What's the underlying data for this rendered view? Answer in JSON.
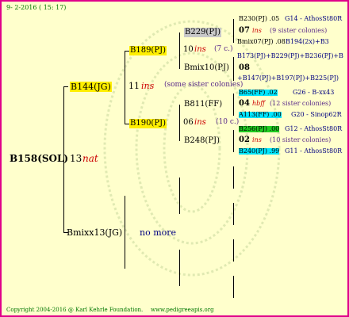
{
  "header": {
    "date": "9-  2-2016 ( 15: 17)"
  },
  "footer": {
    "copyright": "Copyright 2004-2016 @ Karl Kehrle Foundation.",
    "site": "www.pedigreeapis.org"
  },
  "root": {
    "name": "B158(SOL)",
    "num": "13",
    "note": "nat"
  },
  "gen1": {
    "top": {
      "name": "B144(JG)",
      "num": "11",
      "note": "ins",
      "extra": "(some sister colonies)"
    },
    "bottom": {
      "name": "Bmixx13(JG)",
      "extra": "no more"
    }
  },
  "gen2": {
    "a": {
      "name": "B189(PJ)",
      "num": "10",
      "note": "ins",
      "extra": "(7 c.)"
    },
    "b": {
      "name": "B190(PJ)",
      "num": "06",
      "note": "ins",
      "extra": "(10 c.)"
    }
  },
  "gen3": {
    "a": {
      "name": "B229(PJ)"
    },
    "b": {
      "name": "Bmix10(PJ)"
    },
    "c": {
      "name": "B811(FF)"
    },
    "d": {
      "name": "B248(PJ)"
    }
  },
  "gen4": {
    "r1": "B230(PJ) .05",
    "r1b": "G14 - AthosSt80R",
    "r2num": "07",
    "r2note": "ins",
    "r2extra": "(9 sister colonies)",
    "r3": "Bmix07(PJ) .08",
    "r3b": "B194(2x)+B3",
    "r4": "B173(PJ)+B229(PJ)+B236(PJ)+B",
    "r5num": "08",
    "r6": "+B147(PJ)+B197(PJ)+B225(PJ)",
    "r7": "B65(FF) .02",
    "r7b": "G26 - B-xx43",
    "r8num": "04",
    "r8note": "hbff",
    "r8extra": "(12 sister colonies)",
    "r9": "A113(FF) .00",
    "r9b": "G20 - Sinop62R",
    "r10": "B256(PJ) .00",
    "r10b": "G12 - AthosSt80R",
    "r11num": "02",
    "r11note": "ins",
    "r11extra": "(10 sister colonies)",
    "r12": "B240(PJ) .99",
    "r12b": "G11 - AthosSt80R"
  }
}
